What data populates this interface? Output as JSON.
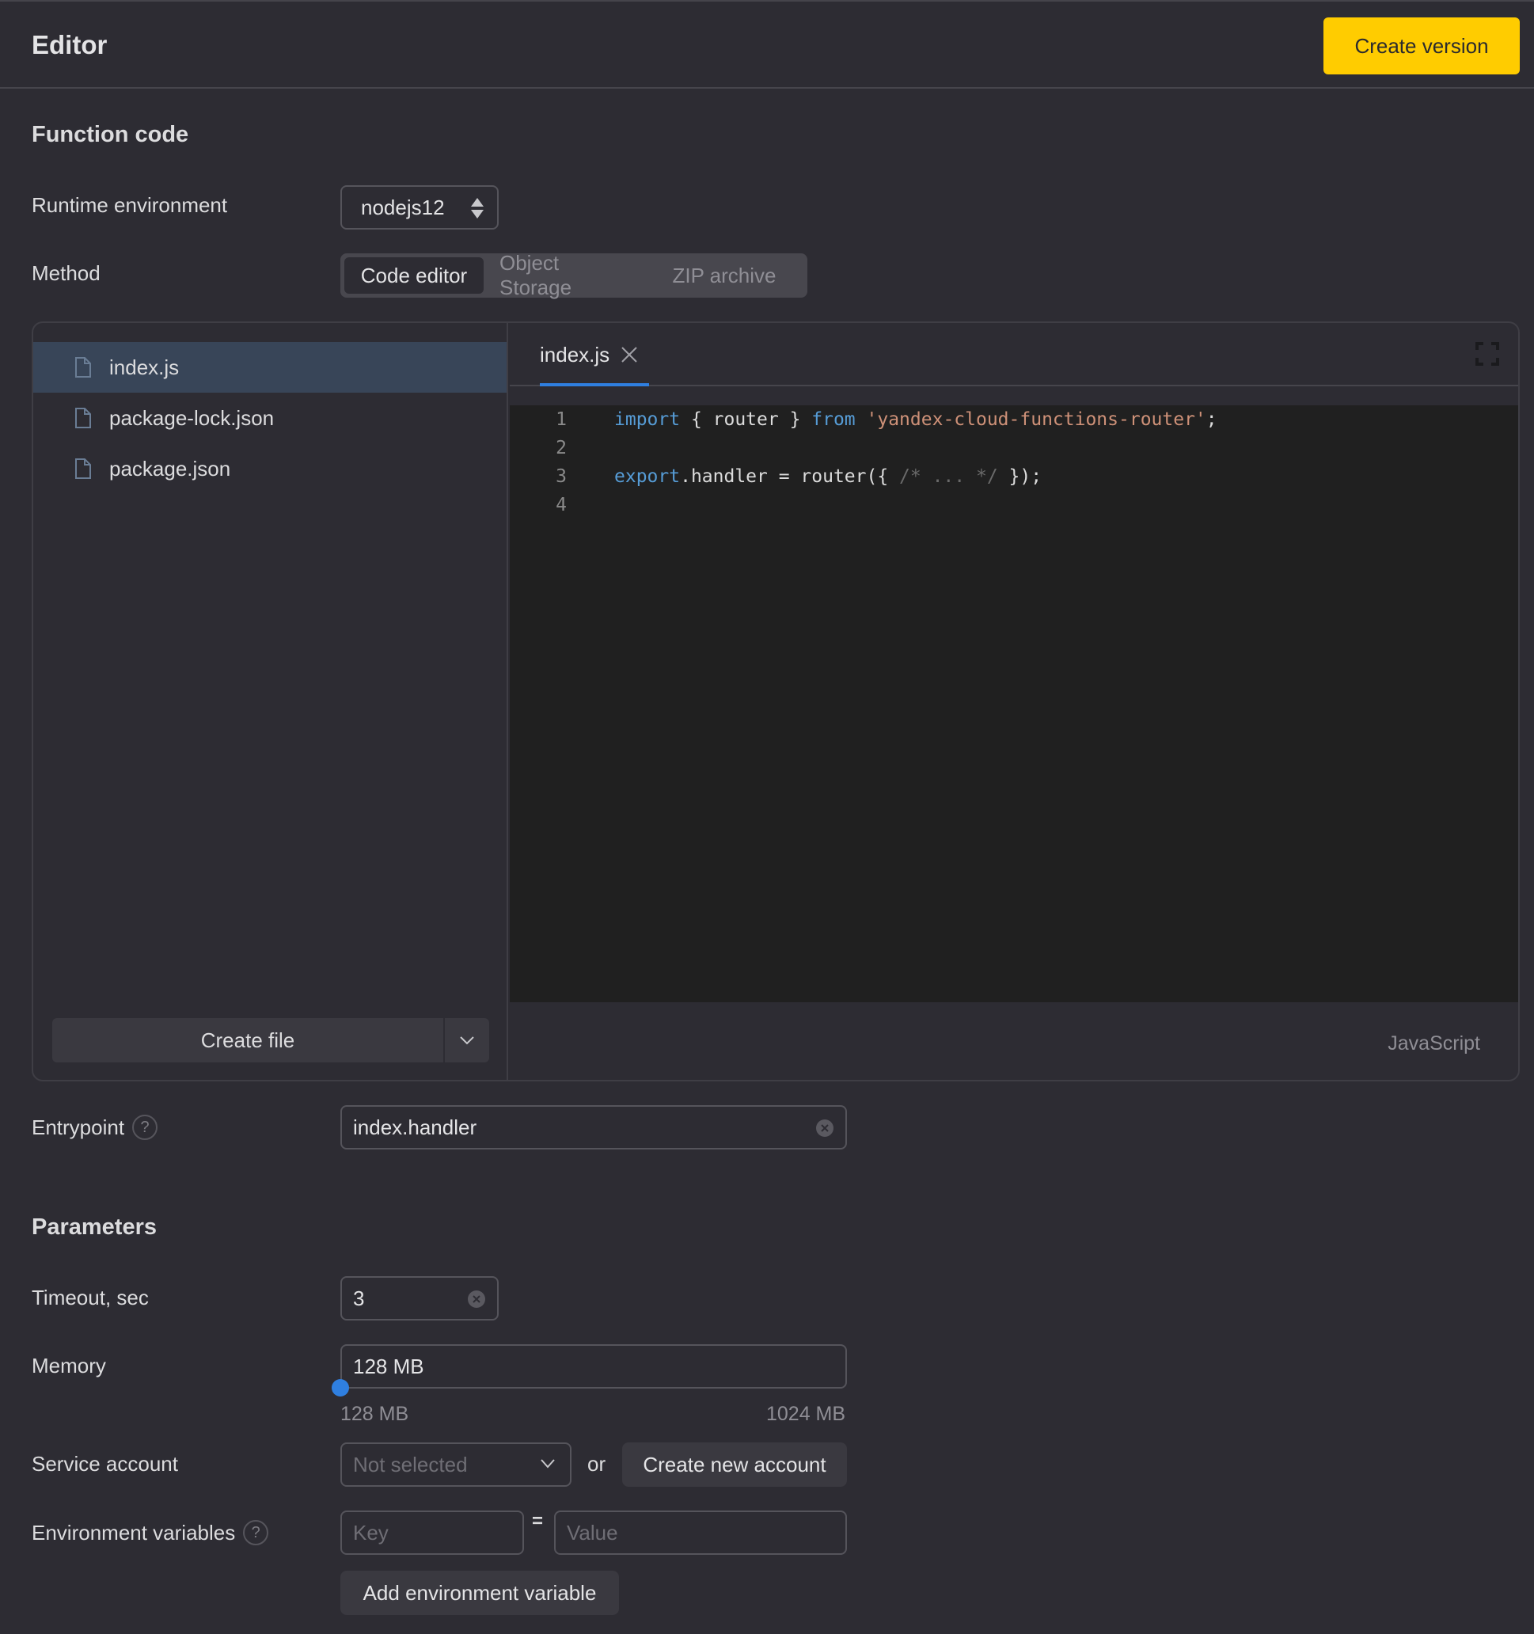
{
  "header": {
    "title": "Editor",
    "create_version_label": "Create version"
  },
  "function_code": {
    "title": "Function code",
    "runtime_label": "Runtime environment",
    "runtime_value": "nodejs12",
    "method_label": "Method",
    "method_options": [
      "Code editor",
      "Object Storage",
      "ZIP archive"
    ],
    "method_selected": "Code editor"
  },
  "file_panel": {
    "files": [
      {
        "name": "index.js",
        "active": true
      },
      {
        "name": "package-lock.json",
        "active": false
      },
      {
        "name": "package.json",
        "active": false
      }
    ],
    "create_file_label": "Create file"
  },
  "code_editor": {
    "open_tab": "index.js",
    "language": "JavaScript",
    "line_numbers": [
      "1",
      "2",
      "3",
      "4"
    ],
    "lines": [
      "import { router } from 'yandex-cloud-functions-router';",
      "",
      "export.handler = router({ /* ... */ });",
      ""
    ]
  },
  "entrypoint": {
    "label": "Entrypoint",
    "value": "index.handler"
  },
  "parameters": {
    "title": "Parameters",
    "timeout_label": "Timeout, sec",
    "timeout_value": "3",
    "memory_label": "Memory",
    "memory_value": "128 MB",
    "memory_min_label": "128 MB",
    "memory_max_label": "1024 MB",
    "memory_slider_fraction": 0,
    "service_account_label": "Service account",
    "service_account_placeholder": "Not selected",
    "or_text": "or",
    "create_account_label": "Create new account",
    "env_label": "Environment variables",
    "env_key_placeholder": "Key",
    "env_equals": "=",
    "env_value_placeholder": "Value",
    "add_env_label": "Add environment variable"
  },
  "colors": {
    "accent_primary": "#ffcc00",
    "accent_blue": "#2f7fe0",
    "background": "#2d2c33",
    "code_background": "#202020"
  }
}
